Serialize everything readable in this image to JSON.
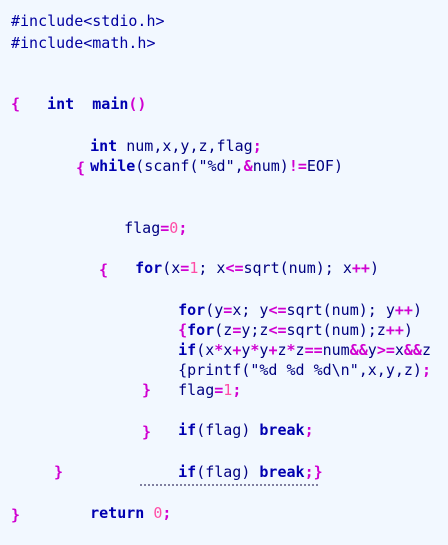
{
  "code": {
    "include1": "#include<stdio.h>",
    "include2": "#include<math.h>",
    "int_kw": "int",
    "main_name": "main",
    "main_parens": "()",
    "lbrace": "{",
    "rbrace": "}",
    "decl_vars": " num,x,y,z,flag",
    "semicolon": ";",
    "while_kw": "while",
    "scanf_pre": "(scanf(\"%d\",",
    "amp": "&",
    "scanf_num": "num)",
    "neq": "!=",
    "eof": "EOF)",
    "flag": "flag",
    "eq": "=",
    "zero": "0",
    "one": "1",
    "for_kw": "for",
    "for1_a": "(x",
    "for1_b": "; x",
    "le": "<=",
    "for1_c": "sqrt(num); x",
    "inc": "++",
    "rparen": ")",
    "for2_a": "(y",
    "for2_b": "x; y",
    "for2_c": "sqrt(num); y",
    "for3_pre": "{",
    "for3_a": "(z",
    "for3_b": "y;z",
    "for3_c": "sqrt(num);z",
    "if_kw": "if",
    "if1_a": "(x",
    "times": "*",
    "plus": "+",
    "eqeq": "==",
    "andand": "&&",
    "ge": ">=",
    "x_txt": "x",
    "y_txt": "y",
    "z_txt": "z",
    "num_txt": "num",
    "if1_tail": "z",
    "printf_pre": "{printf(\"%d %d %d\\n\",x,y,z)",
    "flag_set": "flag",
    "if_flag": "(flag) ",
    "break_kw": "break",
    "return_kw": "return",
    "return_val": " 0"
  }
}
